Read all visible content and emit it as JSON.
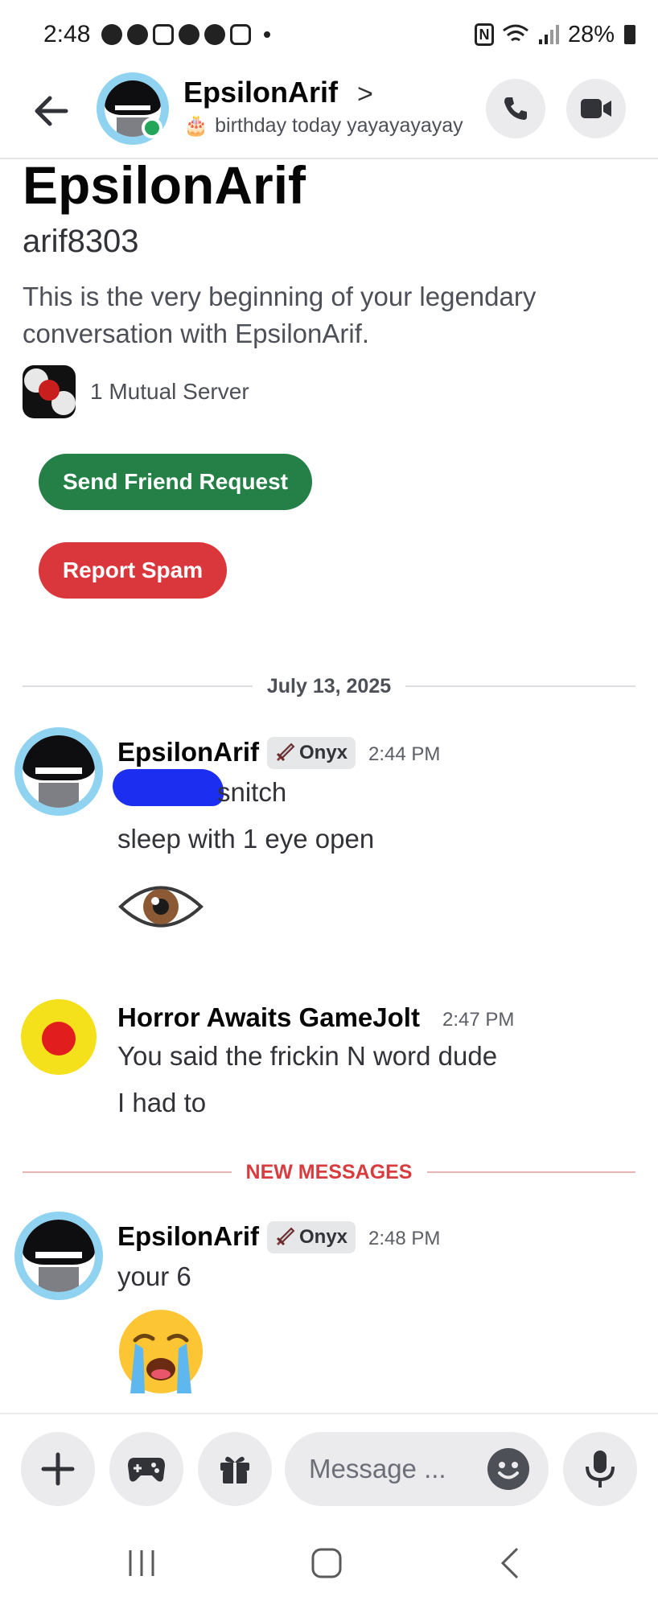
{
  "status_bar": {
    "time": "2:48",
    "battery": "28%"
  },
  "header": {
    "name": "EpsilonArif",
    "chevron": ">",
    "status_emoji": "🎂",
    "status_text": "birthday today yayayayayay",
    "call_icon": "phone-icon",
    "video_icon": "video-icon"
  },
  "intro": {
    "display_name": "EpsilonArif",
    "username": "arif8303",
    "description": "This is the very beginning of your legendary conversation with EpsilonArif.",
    "mutual_servers": "1 Mutual Server",
    "send_friend_request": "Send Friend Request",
    "report_spam": "Report Spam"
  },
  "date_divider": "July 13, 2025",
  "new_messages_divider": "NEW MESSAGES",
  "messages": [
    {
      "author": "EpsilonArif",
      "tag": "Onyx",
      "time": "2:44 PM",
      "lines": [
        "snitch",
        "sleep with 1 eye open"
      ],
      "emoji": "eye"
    },
    {
      "author": "Horror Awaits GameJolt",
      "time": "2:47 PM",
      "lines": [
        "You said the frickin N word dude",
        "I had to"
      ]
    },
    {
      "author": "EpsilonArif",
      "tag": "Onyx",
      "time": "2:48 PM",
      "lines": [
        "your 6"
      ],
      "emoji": "loudly-crying-face"
    }
  ],
  "composer": {
    "placeholder": "Message ...",
    "buttons": [
      "plus-icon",
      "gamepad-icon",
      "gift-icon",
      "emoji-icon",
      "microphone-icon"
    ]
  },
  "colors": {
    "accent_green": "#248046",
    "danger_red": "#da373c",
    "online": "#23a55a",
    "new_messages": "#d83c3e"
  }
}
